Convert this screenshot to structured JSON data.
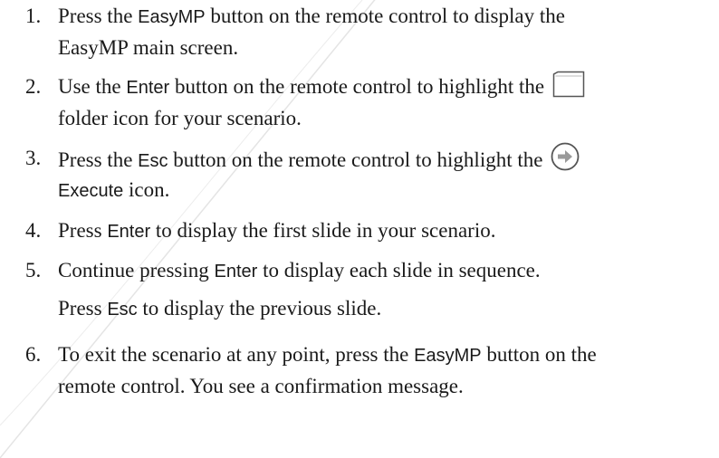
{
  "steps": [
    {
      "number": "1.",
      "lines": [
        [
          "Press the ",
          "EasyMP",
          " button on the remote control to display the"
        ],
        [
          "EasyMP main screen."
        ]
      ]
    },
    {
      "number": "2.",
      "lines": [
        [
          "Use the ",
          "Enter",
          " button on the remote control to highlight the "
        ],
        [
          "folder icon for your scenario."
        ]
      ],
      "icon": "folder-icon"
    },
    {
      "number": "3.",
      "lines": [
        [
          "Press the ",
          "Esc",
          " button on the remote control to highlight the "
        ],
        [
          "Execute",
          " icon."
        ]
      ],
      "icon": "execute-arrow-icon"
    },
    {
      "number": "4.",
      "lines": [
        [
          "Press ",
          "Enter",
          " to display the first slide in your scenario."
        ]
      ]
    },
    {
      "number": "5.",
      "lines": [
        [
          "Continue pressing ",
          "Enter",
          " to display each slide in sequence."
        ]
      ],
      "note": [
        "Press ",
        "Esc",
        " to display the previous slide."
      ]
    },
    {
      "number": "6.",
      "lines": [
        [
          "To exit the scenario at any point, press the ",
          "EasyMP",
          " button on the"
        ],
        [
          "remote control. You see a confirmation message."
        ]
      ]
    }
  ]
}
